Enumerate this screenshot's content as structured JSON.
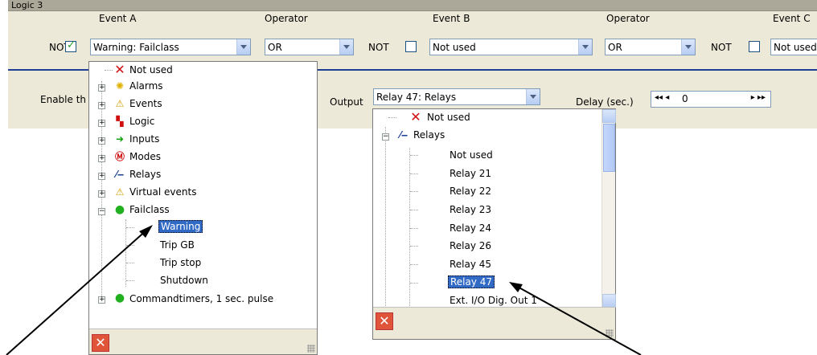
{
  "panel_title": "Logic 3",
  "headers": {
    "event_a": "Event A",
    "operator1": "Operator",
    "event_b": "Event B",
    "operator2": "Operator",
    "event_c": "Event C"
  },
  "row1": {
    "not1": "NOT",
    "event_a_value": "Warning: Failclass",
    "operator1_value": "OR",
    "not2": "NOT",
    "event_b_value": "Not used",
    "operator2_value": "OR",
    "not3": "NOT",
    "event_c_value": "Not used"
  },
  "row2": {
    "enable_label": "Enable th",
    "output_label": "Output",
    "output_value": "Relay 47: Relays",
    "delay_label": "Delay (sec.)",
    "delay_value": "0",
    "delay_left_arrows": "◂◂ ◂",
    "delay_right_arrows": "▸ ▸▸"
  },
  "tree_a": {
    "items": [
      {
        "label": "Not used",
        "icon": "red-x-icon"
      },
      {
        "label": "Alarms",
        "icon": "alarm-icon"
      },
      {
        "label": "Events",
        "icon": "warning-icon"
      },
      {
        "label": "Logic",
        "icon": "logic-icon"
      },
      {
        "label": "Inputs",
        "icon": "input-arrow-icon"
      },
      {
        "label": "Modes",
        "icon": "mode-icon"
      },
      {
        "label": "Relays",
        "icon": "relay-icon"
      },
      {
        "label": "Virtual events",
        "icon": "warning-icon"
      },
      {
        "label": "Failclass",
        "icon": "green-dot-icon"
      },
      {
        "label": "Warning",
        "icon": ""
      },
      {
        "label": "Trip GB",
        "icon": ""
      },
      {
        "label": "Trip stop",
        "icon": ""
      },
      {
        "label": "Shutdown",
        "icon": ""
      },
      {
        "label": "Commandtimers, 1 sec. pulse",
        "icon": "green-dot-icon"
      }
    ]
  },
  "tree_b": {
    "items": [
      {
        "label": "Not used",
        "icon": "red-x-icon"
      },
      {
        "label": "Relays",
        "icon": "relay-icon"
      },
      {
        "label": "Not used",
        "icon": ""
      },
      {
        "label": "Relay 21",
        "icon": ""
      },
      {
        "label": "Relay 22",
        "icon": ""
      },
      {
        "label": "Relay 23",
        "icon": ""
      },
      {
        "label": "Relay 24",
        "icon": ""
      },
      {
        "label": "Relay 26",
        "icon": ""
      },
      {
        "label": "Relay 45",
        "icon": ""
      },
      {
        "label": "Relay 47",
        "icon": ""
      },
      {
        "label": "Ext. I/O Dig. Out 1",
        "icon": ""
      }
    ]
  },
  "colors": {
    "selection": "#316ac5",
    "panel": "#ece9d8",
    "separator": "#1c3f94"
  }
}
